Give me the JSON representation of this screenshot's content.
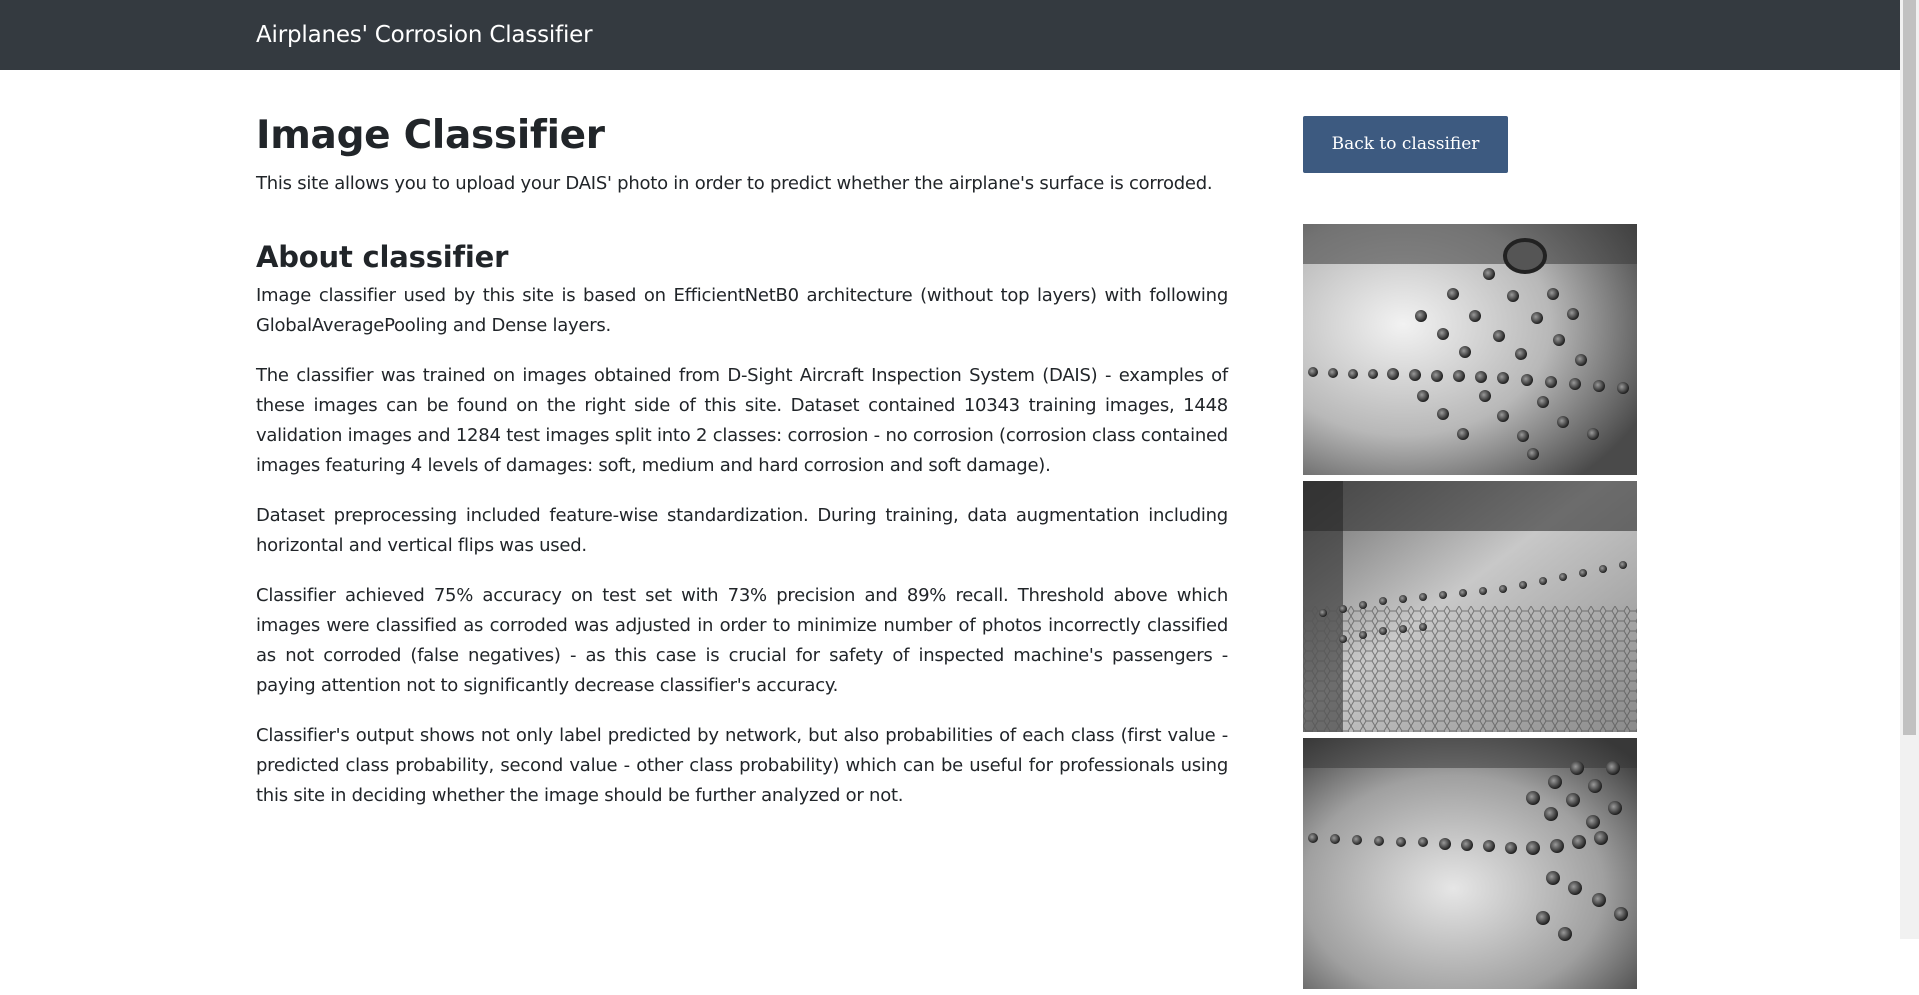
{
  "navbar": {
    "brand": "Airplanes' Corrosion Classifier"
  },
  "main": {
    "title": "Image Classifier",
    "lead": "This site allows you to upload your DAIS' photo in order to predict whether the airplane's surface is corroded.",
    "about_heading": "About classifier",
    "paragraphs": [
      "Image classifier used by this site is based on EfficientNetB0 architecture (without top layers) with following GlobalAveragePooling and Dense layers.",
      "The classifier was trained on images obtained from D-Sight Aircraft Inspection System (DAIS) - examples of these images can be found on the right side of this site. Dataset contained 10343 training images, 1448 validation images and 1284 test images split into 2 classes: corrosion - no corrosion (corrosion class contained images featuring 4 levels of damages: soft, medium and hard corrosion and soft damage).",
      "Dataset preprocessing included feature-wise standardization. During training, data augmentation including horizontal and vertical flips was used.",
      "Classifier achieved 75% accuracy on test set with 73% precision and 89% recall. Threshold above which images were classified as corroded was adjusted in order to minimize number of photos incorrectly classified as not corroded (false negatives) - as this case is crucial for safety of inspected machine's passengers - paying attention not to significantly decrease classifier's accuracy.",
      "Classifier's output shows not only label predicted by network, but also probabilities of each class (first value - predicted class probability, second value - other class probability) which can be useful for professionals using this site in deciding whether the image should be further analyzed or not."
    ]
  },
  "sidebar": {
    "back_button_label": "Back to classifier",
    "sample_images": [
      "dais-sample-image",
      "dais-sample-image",
      "dais-sample-image"
    ]
  },
  "colors": {
    "navbar_bg": "#343a40",
    "button_bg": "#3d5a80",
    "text": "#212529"
  }
}
